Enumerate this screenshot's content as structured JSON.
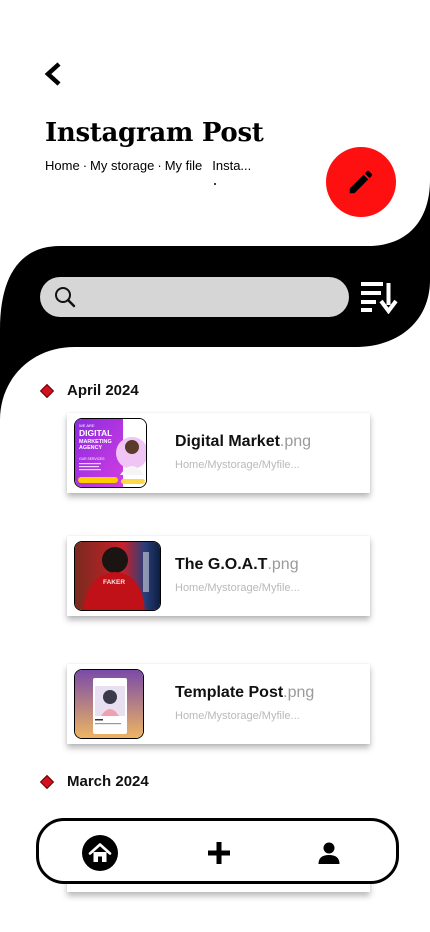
{
  "header": {
    "back_icon": "chevron-left-icon",
    "title": "Instagram Post",
    "breadcrumb": [
      "Home",
      "My storage",
      "My file"
    ],
    "breadcrumb_separator": "·",
    "breadcrumb_current": "Insta..."
  },
  "edit_button": {
    "icon": "pencil-icon",
    "color": "#ff1010"
  },
  "search": {
    "icon": "search-icon",
    "value": "",
    "placeholder": ""
  },
  "sort_button": {
    "icon": "sort-descending-icon"
  },
  "sections": [
    {
      "label": "April 2024",
      "files": [
        {
          "name": "Digital Market",
          "ext": ".png",
          "path": "Home/Mystorage/Myfile...",
          "thumbnail": "digital-marketing-agency-flyer"
        },
        {
          "name": "The G.O.A.T",
          "ext": ".png",
          "path": "Home/Mystorage/Myfile...",
          "thumbnail": "faker-red-jacket-photo"
        },
        {
          "name": "Template Post",
          "ext": ".png",
          "path": "Home/Mystorage/Myfile...",
          "thumbnail": "instagram-template-mockup"
        }
      ]
    },
    {
      "label": "March 2024",
      "files": []
    }
  ],
  "thumb_text": {
    "dm_we_are": "WE ARE",
    "dm_line1": "DIGITAL",
    "dm_line2": "MARKETING",
    "dm_line3": "AGENCY",
    "dm_services": "OUR SERVICES",
    "goat_jacket": "FAKER"
  },
  "bottom_nav": [
    {
      "icon": "home-icon",
      "active": true
    },
    {
      "icon": "plus-icon",
      "active": false
    },
    {
      "icon": "user-icon",
      "active": false
    }
  ],
  "colors": {
    "accent_red": "#ff1010",
    "diamond_red": "#d1111f",
    "black_band": "#000000",
    "search_bg": "#d6d6d6"
  }
}
